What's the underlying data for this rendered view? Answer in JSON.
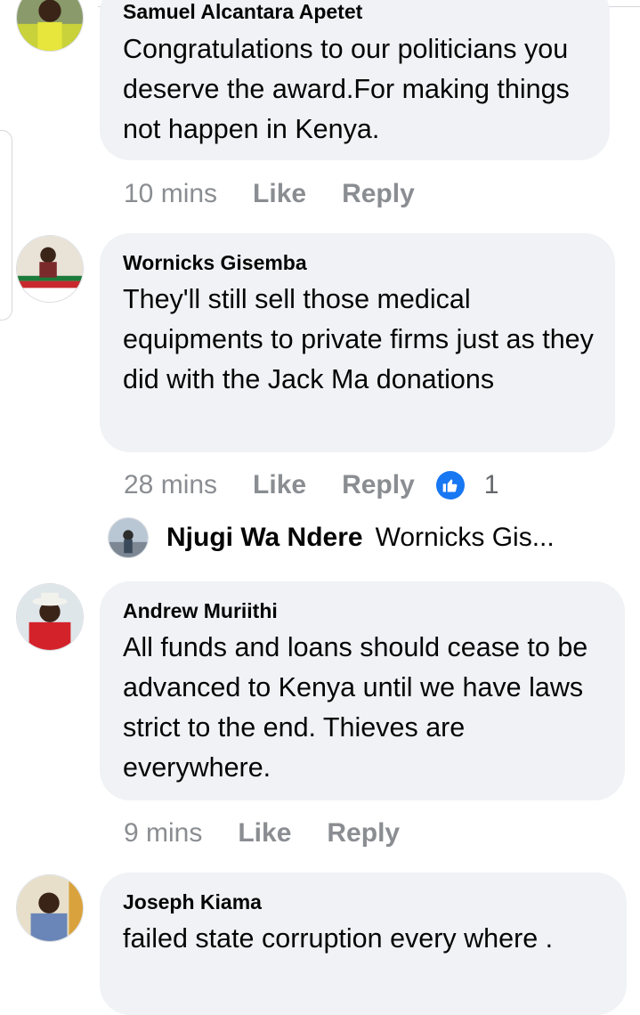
{
  "comments": [
    {
      "author": "Samuel Alcantara Apetet",
      "text": "Congratulations to our politicians you deserve the award.For making things not happen in Kenya.",
      "time": "10 mins",
      "like": "Like",
      "reply": "Reply"
    },
    {
      "author": "Wornicks Gisemba",
      "text": "They'll still sell those medical equipments to private firms just as they did with the Jack Ma donations",
      "time": "28 mins",
      "like": "Like",
      "reply": "Reply",
      "reaction_count": "1"
    },
    {
      "author": "Andrew Muriithi",
      "text": "All funds and loans should cease to be advanced to Kenya until we have laws strict to the end. Thieves are everywhere.",
      "time": "9 mins",
      "like": "Like",
      "reply": "Reply"
    },
    {
      "author": "Joseph Kiama",
      "text": "failed  state  corruption every where .",
      "time": "",
      "like": "",
      "reply": ""
    }
  ],
  "reply_preview": {
    "author": "Njugi Wa Ndere",
    "snippet": "Wornicks Gis..."
  },
  "icons": {
    "reaction": "thumbs-up-icon"
  },
  "colors": {
    "bubble": "#f0f2f5",
    "meta": "#8a8d91",
    "like_blue": "#1877f2"
  }
}
